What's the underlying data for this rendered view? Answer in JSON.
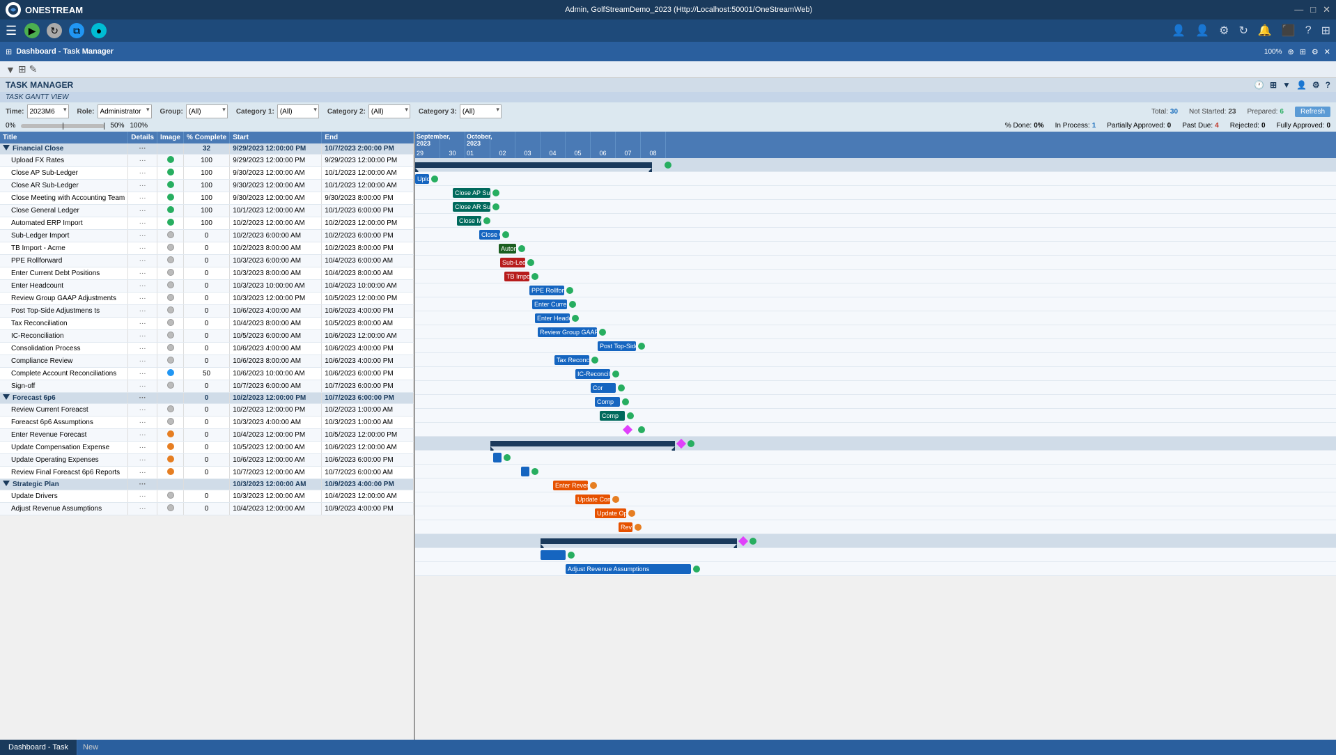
{
  "titleBar": {
    "appName": "ONESTREAM",
    "centerTitle": "Admin, GolfStreamDemo_2023 (Http://Localhost:50001/OneStreamWeb)",
    "winControls": [
      "—",
      "□",
      "✕"
    ]
  },
  "menuBar": {
    "hamburger": "☰",
    "buttons": [
      "●",
      "↻",
      "⧉",
      "●"
    ]
  },
  "dashTab": {
    "title": "Dashboard - Task Manager",
    "zoomLabel": "100%"
  },
  "taskManager": {
    "title": "TASK MANAGER",
    "ganttView": "TASK GANTT VIEW"
  },
  "controls": {
    "timeLabel": "Time:",
    "timeValue": "2023M6",
    "roleLabel": "Role:",
    "roleValue": "Administrator",
    "groupLabel": "Group:",
    "groupValue": "(All)",
    "cat1Label": "Category 1:",
    "cat1Value": "(All)",
    "cat2Label": "Category 2:",
    "cat2Value": "(All)",
    "cat3Label": "Category 3:",
    "cat3Value": "(All)"
  },
  "stats": {
    "total": "30",
    "notStarted": "23",
    "prepared": "6",
    "pctDone": "0%",
    "inProcess": "1",
    "partiallyApproved": "0",
    "pastDue": "4",
    "rejected": "0",
    "fullyApproved": "0",
    "refreshLabel": "Refresh"
  },
  "columns": {
    "title": "Title",
    "details": "Details",
    "image": "Image",
    "pctComplete": "% Complete",
    "start": "Start",
    "end": "End"
  },
  "ganttMonths": [
    {
      "label": "September, 2023",
      "days": [
        "29",
        "30"
      ]
    },
    {
      "label": "October, 2023",
      "days": [
        "01",
        "02",
        "03",
        "04",
        "05",
        "06",
        "07",
        "08"
      ]
    }
  ],
  "tasks": [
    {
      "id": "g1",
      "type": "group",
      "indent": 0,
      "title": "Financial Close",
      "pct": "32",
      "start": "9/29/2023 12:00:00 PM",
      "end": "10/7/2023 2:00:00 PM"
    },
    {
      "id": "t1",
      "type": "task",
      "indent": 1,
      "title": "Upload FX Rates",
      "pct": "100",
      "statusCircle": "green",
      "start": "9/29/2023 12:00:00 PM",
      "end": "9/29/2023 12:00:00 PM"
    },
    {
      "id": "t2",
      "type": "task",
      "indent": 1,
      "title": "Close AP Sub-Ledger",
      "pct": "100",
      "statusCircle": "green",
      "start": "9/30/2023 12:00:00 AM",
      "end": "10/1/2023 12:00:00 AM"
    },
    {
      "id": "t3",
      "type": "task",
      "indent": 1,
      "title": "Close AR Sub-Ledger",
      "pct": "100",
      "statusCircle": "green",
      "start": "9/30/2023 12:00:00 AM",
      "end": "10/1/2023 12:00:00 AM"
    },
    {
      "id": "t4",
      "type": "task",
      "indent": 1,
      "title": "Close Meeting with Accounting Team",
      "pct": "100",
      "statusCircle": "green",
      "start": "9/30/2023 12:00:00 AM",
      "end": "9/30/2023 8:00:00 PM"
    },
    {
      "id": "t5",
      "type": "task",
      "indent": 1,
      "title": "Close General Ledger",
      "pct": "100",
      "statusCircle": "green",
      "start": "10/1/2023 12:00:00 AM",
      "end": "10/1/2023 6:00:00 PM"
    },
    {
      "id": "t6",
      "type": "task",
      "indent": 1,
      "title": "Automated ERP Import",
      "pct": "100",
      "statusCircle": "green",
      "start": "10/2/2023 12:00:00 AM",
      "end": "10/2/2023 12:00:00 PM"
    },
    {
      "id": "t7",
      "type": "task",
      "indent": 1,
      "title": "Sub-Ledger Import",
      "pct": "0",
      "statusCircle": "gray",
      "start": "10/2/2023 6:00:00 AM",
      "end": "10/2/2023 6:00:00 PM"
    },
    {
      "id": "t8",
      "type": "task",
      "indent": 1,
      "title": "TB Import - Acme",
      "pct": "0",
      "statusCircle": "gray",
      "start": "10/2/2023 8:00:00 AM",
      "end": "10/2/2023 8:00:00 PM"
    },
    {
      "id": "t9",
      "type": "task",
      "indent": 1,
      "title": "PPE Rollforward",
      "pct": "0",
      "statusCircle": "gray",
      "start": "10/3/2023 6:00:00 AM",
      "end": "10/4/2023 6:00:00 AM"
    },
    {
      "id": "t10",
      "type": "task",
      "indent": 1,
      "title": "Enter Current Debt Positions",
      "pct": "0",
      "statusCircle": "gray",
      "start": "10/3/2023 8:00:00 AM",
      "end": "10/4/2023 8:00:00 AM"
    },
    {
      "id": "t11",
      "type": "task",
      "indent": 1,
      "title": "Enter Headcount",
      "pct": "0",
      "statusCircle": "gray",
      "start": "10/3/2023 10:00:00 AM",
      "end": "10/4/2023 10:00:00 AM"
    },
    {
      "id": "t12",
      "type": "task",
      "indent": 1,
      "title": "Review Group GAAP Adjustments",
      "pct": "0",
      "statusCircle": "gray",
      "start": "10/3/2023 12:00:00 PM",
      "end": "10/5/2023 12:00:00 PM"
    },
    {
      "id": "t13",
      "type": "task",
      "indent": 1,
      "title": "Post Top-Side Adjustmens ts",
      "pct": "0",
      "statusCircle": "gray",
      "start": "10/6/2023 4:00:00 AM",
      "end": "10/6/2023 4:00:00 PM"
    },
    {
      "id": "t14",
      "type": "task",
      "indent": 1,
      "title": "Tax Reconciliation",
      "pct": "0",
      "statusCircle": "gray",
      "start": "10/4/2023 8:00:00 AM",
      "end": "10/5/2023 8:00:00 AM"
    },
    {
      "id": "t15",
      "type": "task",
      "indent": 1,
      "title": "IC-Reconciliation",
      "pct": "0",
      "statusCircle": "gray",
      "start": "10/5/2023 6:00:00 AM",
      "end": "10/6/2023 12:00:00 AM"
    },
    {
      "id": "t16",
      "type": "task",
      "indent": 1,
      "title": "Consolidation Process",
      "pct": "0",
      "statusCircle": "gray",
      "start": "10/6/2023 4:00:00 AM",
      "end": "10/6/2023 4:00:00 PM"
    },
    {
      "id": "t17",
      "type": "task",
      "indent": 1,
      "title": "Compliance Review",
      "pct": "0",
      "statusCircle": "gray",
      "start": "10/6/2023 8:00:00 AM",
      "end": "10/6/2023 4:00:00 PM"
    },
    {
      "id": "t18",
      "type": "task",
      "indent": 1,
      "title": "Complete Account Reconciliations",
      "pct": "50",
      "statusCircle": "blue",
      "start": "10/6/2023 10:00:00 AM",
      "end": "10/6/2023 6:00:00 PM"
    },
    {
      "id": "t19",
      "type": "task",
      "indent": 1,
      "title": "Sign-off",
      "pct": "0",
      "statusCircle": "gray",
      "start": "10/7/2023 6:00:00 AM",
      "end": "10/7/2023 6:00:00 PM"
    },
    {
      "id": "g2",
      "type": "group",
      "indent": 0,
      "title": "Forecast 6p6",
      "pct": "0",
      "start": "10/2/2023 12:00:00 PM",
      "end": "10/7/2023 6:00:00 PM"
    },
    {
      "id": "t20",
      "type": "task",
      "indent": 1,
      "title": "Review Current Foreacst",
      "pct": "0",
      "statusCircle": "gray",
      "start": "10/2/2023 12:00:00 PM",
      "end": "10/2/2023 1:00:00 AM"
    },
    {
      "id": "t21",
      "type": "task",
      "indent": 1,
      "title": "Foreacst 6p6 Assumptions",
      "pct": "0",
      "statusCircle": "gray",
      "start": "10/3/2023 4:00:00 AM",
      "end": "10/3/2023 1:00:00 AM"
    },
    {
      "id": "t22",
      "type": "task",
      "indent": 1,
      "title": "Enter Revenue Forecast",
      "pct": "0",
      "statusCircle": "orange",
      "start": "10/4/2023 12:00:00 PM",
      "end": "10/5/2023 12:00:00 PM"
    },
    {
      "id": "t23",
      "type": "task",
      "indent": 1,
      "title": "Update Compensation Expense",
      "pct": "0",
      "statusCircle": "orange",
      "start": "10/5/2023 12:00:00 AM",
      "end": "10/6/2023 12:00:00 AM"
    },
    {
      "id": "t24",
      "type": "task",
      "indent": 1,
      "title": "Update Operating Expenses",
      "pct": "0",
      "statusCircle": "orange",
      "start": "10/6/2023 12:00:00 AM",
      "end": "10/6/2023 6:00:00 PM"
    },
    {
      "id": "t25",
      "type": "task",
      "indent": 1,
      "title": "Review Final Foreacst 6p6 Reports",
      "pct": "0",
      "statusCircle": "orange",
      "start": "10/7/2023 12:00:00 AM",
      "end": "10/7/2023 6:00:00 AM"
    },
    {
      "id": "g3",
      "type": "group",
      "indent": 0,
      "title": "Strategic Plan",
      "pct": "",
      "start": "10/3/2023 12:00:00 AM",
      "end": "10/9/2023 4:00:00 PM"
    },
    {
      "id": "t26",
      "type": "task",
      "indent": 1,
      "title": "Update Drivers",
      "pct": "0",
      "statusCircle": "gray",
      "start": "10/3/2023 12:00:00 AM",
      "end": "10/4/2023 12:00:00 AM"
    },
    {
      "id": "t27",
      "type": "task",
      "indent": 1,
      "title": "Adjust Revenue Assumptions",
      "pct": "0",
      "statusCircle": "gray",
      "start": "10/4/2023 12:00:00 AM",
      "end": "10/9/2023 4:00:00 PM"
    }
  ],
  "bottomTabs": [
    {
      "label": "Dashboard - Task",
      "active": true
    },
    {
      "label": "New",
      "active": false
    }
  ]
}
